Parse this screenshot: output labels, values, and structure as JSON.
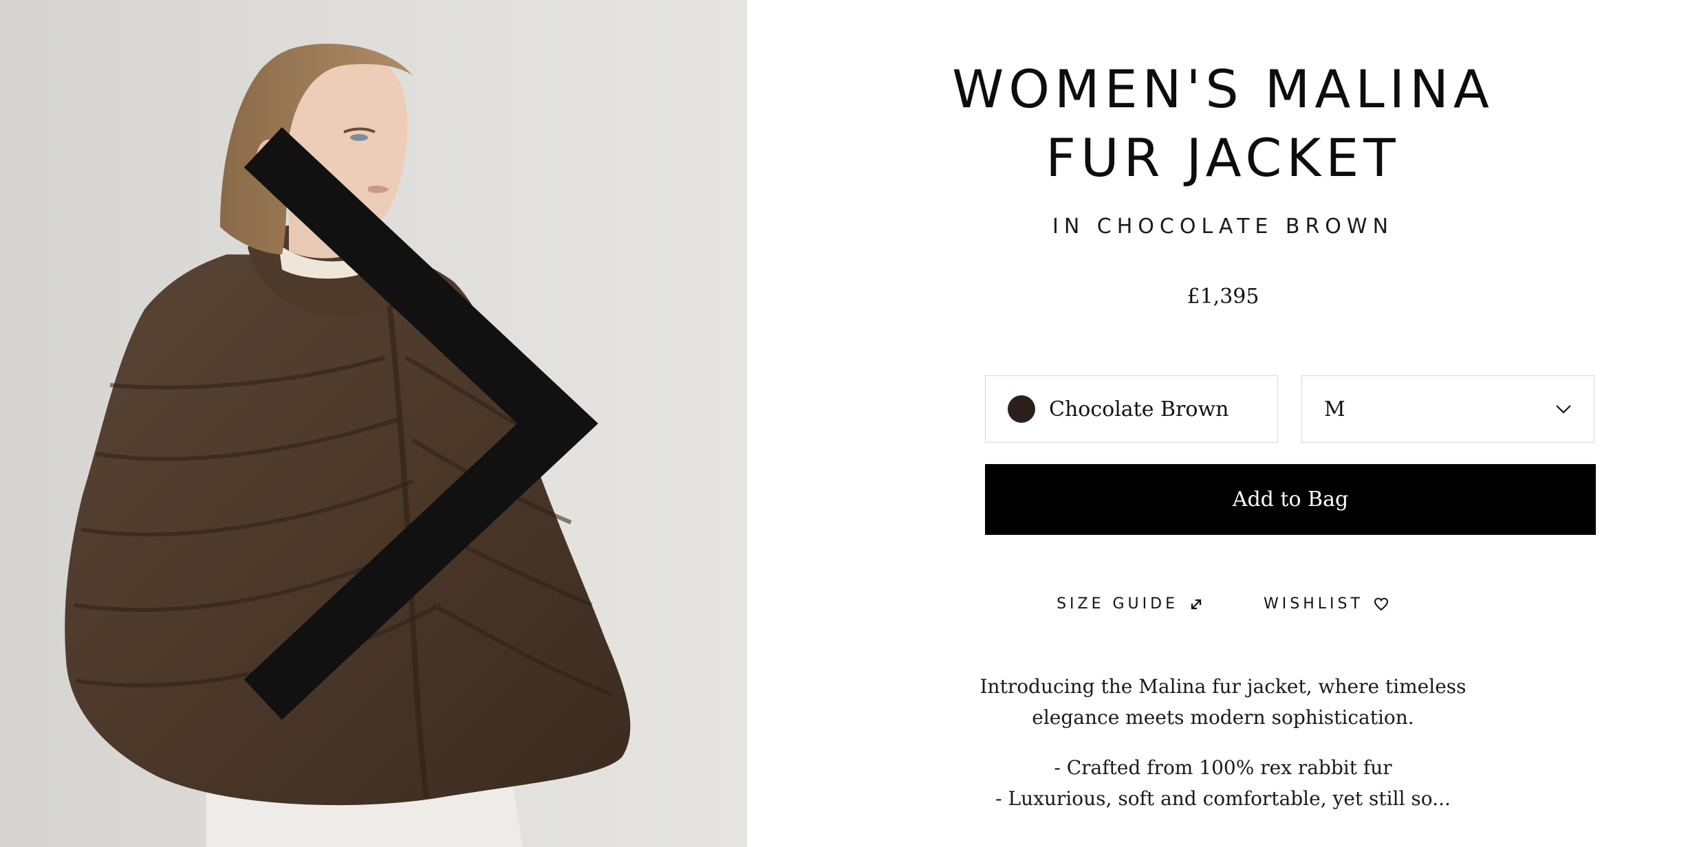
{
  "product": {
    "title_line1": "WOMEN'S MALINA",
    "title_line2": "FUR JACKET",
    "subtitle": "IN CHOCOLATE BROWN",
    "price": "£1,395"
  },
  "options": {
    "color": {
      "label": "Chocolate Brown",
      "swatch_color": "#2a1f1b"
    },
    "size": {
      "selected": "M"
    }
  },
  "actions": {
    "add_to_bag": "Add to Bag",
    "size_guide": "SIZE GUIDE",
    "wishlist": "WISHLIST"
  },
  "description": {
    "intro": "Introducing the Malina fur jacket, where timeless elegance meets modern sophistication.",
    "bullets": [
      "- Crafted from 100% rex rabbit fur",
      "- Luxurious, soft and comfortable, yet still so..."
    ]
  },
  "icons": {
    "next": "chevron-right-icon",
    "dropdown": "chevron-down-icon",
    "size_guide": "resize-arrows-icon",
    "wishlist": "heart-icon"
  },
  "colors": {
    "button_bg": "#000000",
    "button_text": "#ffffff",
    "border": "#d7d7d7",
    "image_bg": "#dcdbd8"
  }
}
